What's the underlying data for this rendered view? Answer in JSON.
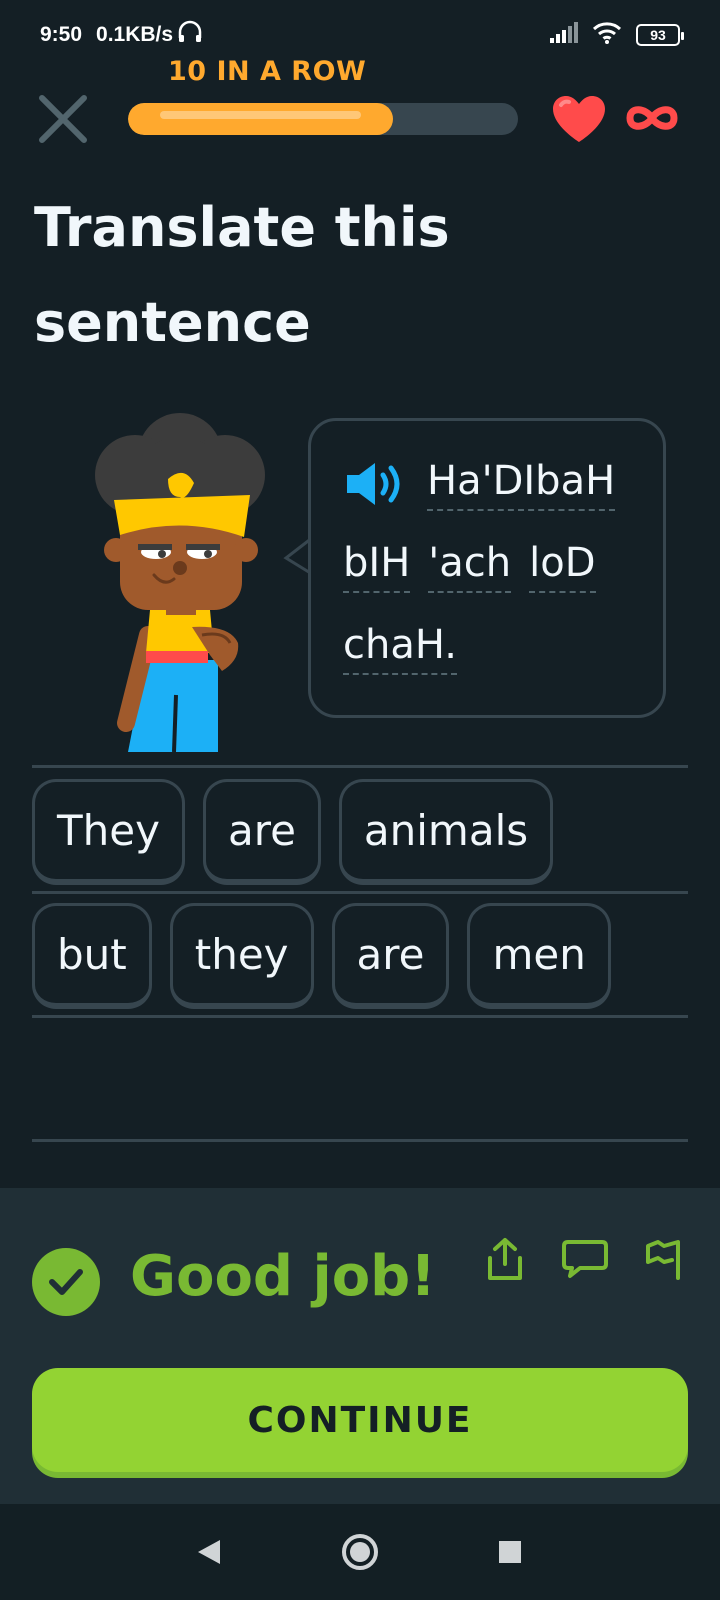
{
  "status_bar": {
    "time": "9:50",
    "network_speed": "0.1KB/s",
    "battery": "93",
    "icons": [
      "headphones-icon",
      "signal-icon",
      "wifi-icon",
      "battery-icon"
    ]
  },
  "lesson_header": {
    "streak_label": "10 IN A ROW",
    "progress_fraction": 0.68,
    "hearts": "∞"
  },
  "prompt": {
    "title": "Translate this sentence"
  },
  "sentence": {
    "words": [
      "Ha'DIbaH",
      "bIH",
      "'ach",
      "loD",
      "chaH."
    ]
  },
  "answer": {
    "row1": [
      "They",
      "are",
      "animals"
    ],
    "row2": [
      "but",
      "they",
      "are",
      "men"
    ]
  },
  "feedback": {
    "message": "Good job!",
    "continue_label": "CONTINUE"
  },
  "colors": {
    "background": "#141f25",
    "panel": "#202f36",
    "accent_green": "#93d333",
    "text_green": "#79b933",
    "streak_orange": "#ffa92e",
    "heart_red": "#ff4b4b",
    "speaker_blue": "#1cb0f6"
  }
}
